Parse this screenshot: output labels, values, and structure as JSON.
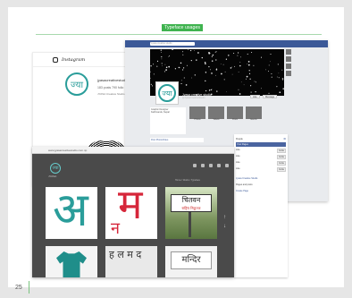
{
  "header": {
    "tag": "Typeface usages"
  },
  "footer": {
    "page_number": "25"
  },
  "instagram": {
    "wordmark": "Instagram",
    "avatar_glyph": "ज्या",
    "profile_name": "jyasacreativestudio",
    "stats": "183 posts   790 follo",
    "bio": "JYASA Creative Studio"
  },
  "facebook": {
    "search": "Jyasa creative studio",
    "avatar_glyph": "ज्या",
    "page_title": "Jyasa creative studio",
    "page_sub": "@JyasaCreativeStudio",
    "like_btn": "Like",
    "message_btn": "Message",
    "post_label": "Post   Photo/Video",
    "thumb_labels": [
      "Photos",
      "Videos",
      "Posts",
      "Events"
    ],
    "info": [
      "Graphic Designer",
      "Kathmandu, Nepal"
    ]
  },
  "sidebar": {
    "rows": [
      {
        "label": "People",
        "value": "30"
      },
      {
        "label": "Like",
        "value": "Invite"
      },
      {
        "label": "Like",
        "value": "Invite"
      },
      {
        "label": "Like",
        "value": "Invite"
      },
      {
        "label": "Like",
        "value": "Invite"
      }
    ],
    "header": "Your Pages",
    "links": [
      "Jyasa Creative Studio",
      "Pages and posts",
      "Create Page"
    ]
  },
  "website": {
    "url": "www.jyasacreativestudio.com.np",
    "logo_glyph": "ज्या",
    "logo_text": "JYASA",
    "crumb": "Home / Works / Typeface",
    "tiles": {
      "t1": "अ",
      "t2_a": "म",
      "t2_b": "न",
      "t3_main": "चितवन",
      "t3_sub": "राष्ट्रिय निकुञ्ज",
      "t5": "ह ल म द",
      "t6": "मन्दिर"
    }
  },
  "colors": {
    "accent_green": "#3fb34f",
    "teal": "#2a9d9a",
    "devanagari_red": "#d6263a",
    "facebook_blue": "#3b5998"
  }
}
